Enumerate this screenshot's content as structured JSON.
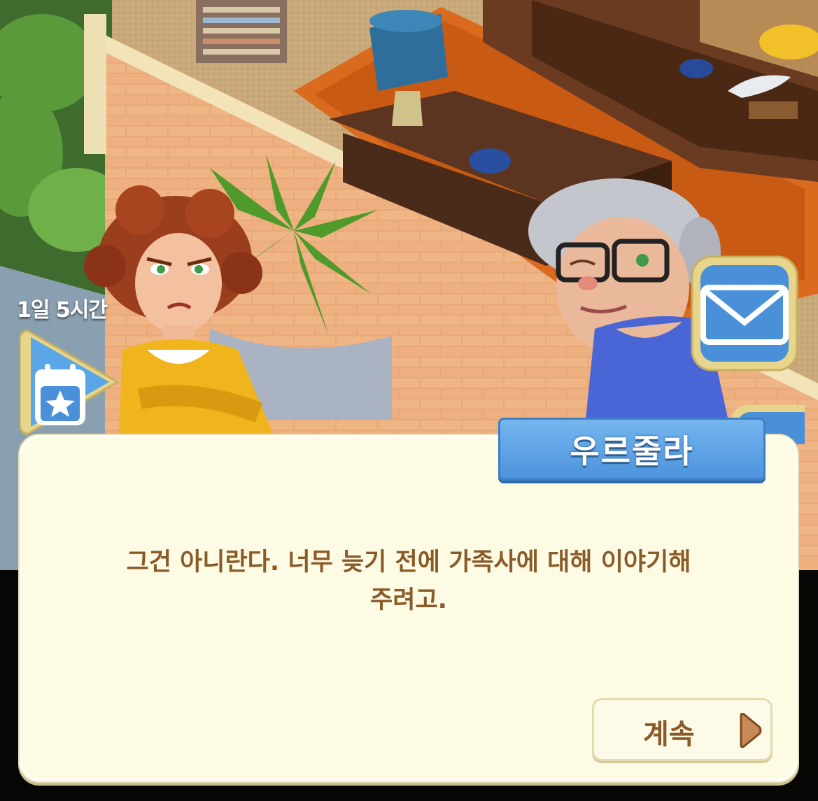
{
  "event": {
    "timer_text": "1일 5시간",
    "icon": "calendar-star-icon"
  },
  "side_buttons": {
    "mail_icon": "envelope-icon"
  },
  "dialog": {
    "speaker": "우르줄라",
    "line1": "그건 아니란다. 너무 늦기 전에 가족사에 대해 이야기해",
    "line2": "주려고.",
    "continue_label": "계속",
    "continue_icon": "triangle-right-icon"
  },
  "colors": {
    "dialog_bg": "#fdfbe3",
    "dialog_text": "#8a5a28",
    "nameplate": "#5a9fe4",
    "button_blue": "#4a90d9"
  }
}
